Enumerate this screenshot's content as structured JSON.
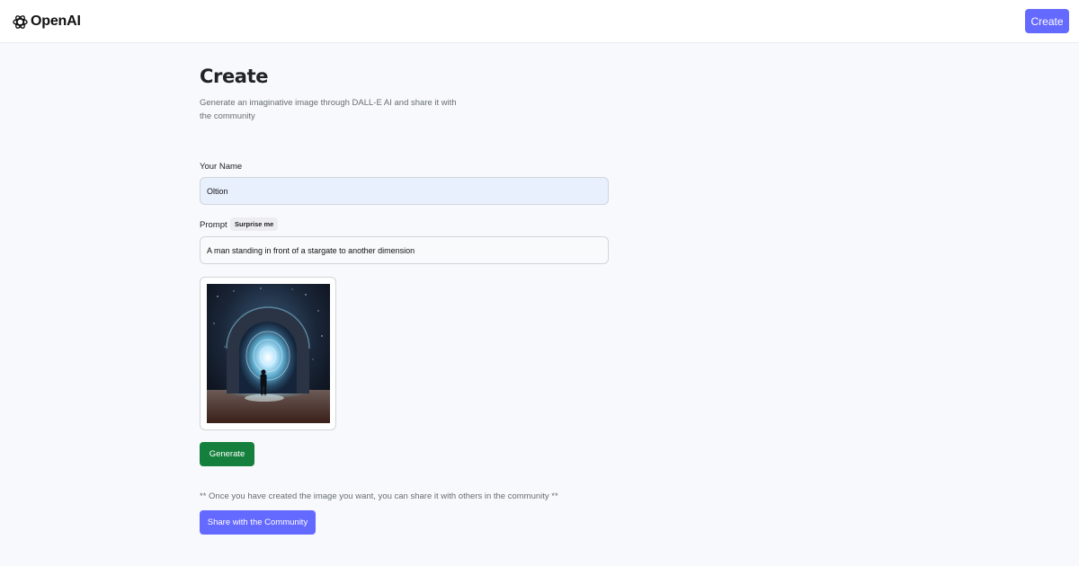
{
  "header": {
    "brand": "OpenAI",
    "brand_icon": "openai-logo-icon",
    "create_label": "Create"
  },
  "main": {
    "title": "Create",
    "subtitle": "Generate an imaginative image through DALL-E AI and share it with the community"
  },
  "form": {
    "name_label": "Your Name",
    "name_value": "Oltion",
    "prompt_label": "Prompt",
    "surprise_label": "Surprise me",
    "prompt_value": "A man standing in front of a stargate to another dimension"
  },
  "preview": {
    "image_subject": "man-before-glowing-stargate-image"
  },
  "actions": {
    "generate_label": "Generate",
    "share_note": "** Once you have created the image you want, you can share it with others in the community **",
    "share_label": "Share with the Community"
  },
  "colors": {
    "accent": "#6469ff",
    "generate": "#15803d",
    "background": "#f8f9fc",
    "name_field_bg": "#e8f0fe"
  }
}
